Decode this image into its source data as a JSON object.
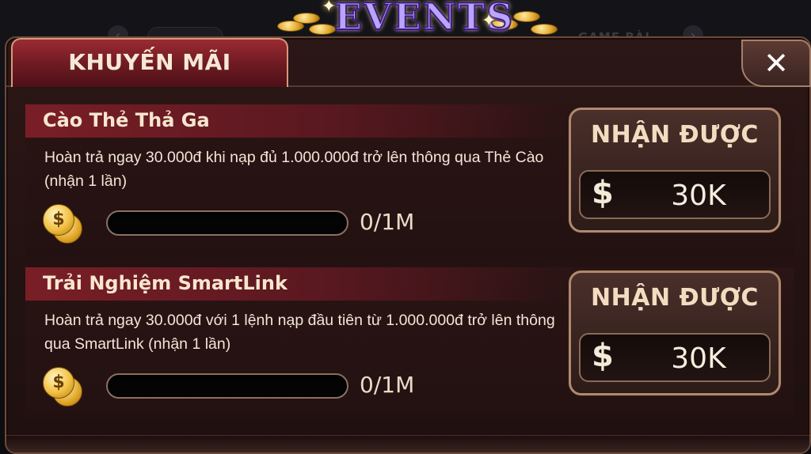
{
  "header": {
    "title": "EVENTS",
    "background_right_hint": "GAME BÀI"
  },
  "tab": {
    "label": "KHUYẾN MÃI"
  },
  "close_button": {
    "label": "✕"
  },
  "promotions": [
    {
      "title": "Cào Thẻ Thả Ga",
      "description": "Hoàn trả ngay 30.000đ khi nạp đủ 1.000.000đ trở lên thông qua Thẻ Cào (nhận 1 lần)",
      "coin_symbol": "$",
      "progress_text": "0/1M",
      "progress_fraction": 0,
      "claim_label": "NHẬN ĐƯỢC",
      "reward_currency": "$",
      "reward_value": "30K"
    },
    {
      "title": "Trải Nghiệm SmartLink",
      "description": "Hoàn trả ngay 30.000đ với 1 lệnh nạp đầu tiên từ 1.000.000đ trở lên thông qua SmartLink (nhận 1 lần)",
      "coin_symbol": "$",
      "progress_text": "0/1M",
      "progress_fraction": 0,
      "claim_label": "NHẬN ĐƯỢC",
      "reward_currency": "$",
      "reward_value": "30K"
    }
  ],
  "colors": {
    "tab_red": "#9b2a33",
    "panel_bg": "#2b1716",
    "border_gold": "#b08a6e",
    "text_cream": "#f3dcc0",
    "coin_gold": "#f1c042"
  }
}
